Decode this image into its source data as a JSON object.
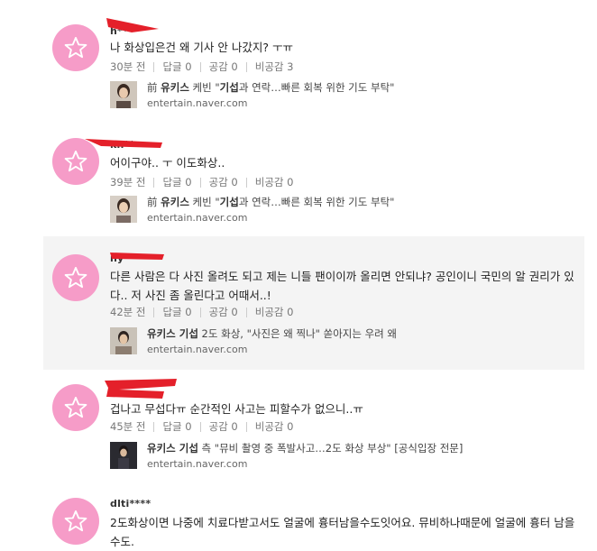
{
  "comments": [
    {
      "nickname": "h**",
      "text": "나 화상입은건 왜 기사 안 나갔지? ㅜㅠ",
      "time": "30분 전",
      "reply": "답글 0",
      "like": "공감 0",
      "dislike": "비공감 3",
      "link_title": "前 유키스 케빈 \"기섭과 연락…빠른 회복 위한 기도 부탁\"",
      "link_domain": "entertain.naver.com"
    },
    {
      "nickname": "kh**",
      "text": "어이구야.. ㅜ 이도화상..",
      "time": "39분 전",
      "reply": "답글 0",
      "like": "공감 0",
      "dislike": "비공감 0",
      "link_title": "前 유키스 케빈 \"기섭과 연락…빠른 회복 위한 기도 부탁\"",
      "link_domain": "entertain.naver.com"
    },
    {
      "nickname": "ny**",
      "text": "다른 사람은 다 사진 올려도 되고 제는 니들 팬이이까 올리면 안되냐? 공인이니 국민의 알 권리가 있다.. 저 사진 좀 올린다고 어때서..!",
      "time": "42분 전",
      "reply": "답글 0",
      "like": "공감 0",
      "dislike": "비공감 0",
      "link_title": "유키스 기섭 2도 화상, \"사진은 왜 찍나\" 쏟아지는 우려 왜",
      "link_domain": "entertain.naver.com"
    },
    {
      "nickname": "",
      "text": "겁나고 무섭다ㅠ 순간적인 사고는 피할수가 없으니..ㅠ",
      "time": "45분 전",
      "reply": "답글 0",
      "like": "공감 0",
      "dislike": "비공감 0",
      "link_title": "유키스 기섭 측 \"뮤비 촬영 중 폭발사고…2도 화상 부상\" [공식입장 전문]",
      "link_domain": "entertain.naver.com"
    },
    {
      "nickname": "dlti****",
      "text": "2도화상이면 나중에 치료다받고서도 얼굴에 흉터남을수도잇어요. 뮤비하나때문에 얼굴에 흉터 남을수도.",
      "time": "",
      "reply": "",
      "like": "",
      "dislike": "",
      "link_title": "",
      "link_domain": ""
    }
  ],
  "colors": {
    "avatar": "#f69cc8",
    "redaction": "#e4202a",
    "highlight_row": "#f4f4f4"
  },
  "icons": {
    "avatar": "star-outline-icon"
  }
}
